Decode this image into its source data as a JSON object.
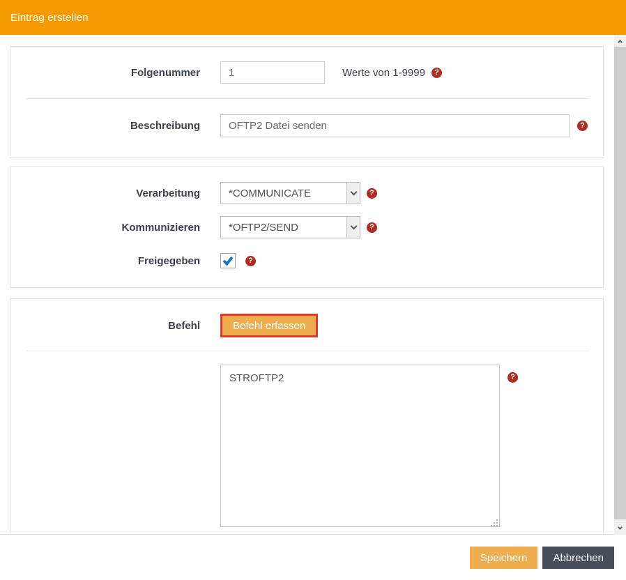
{
  "header": {
    "title": "Eintrag erstellen"
  },
  "form": {
    "folgenummer": {
      "label": "Folgenummer",
      "value": "1",
      "hint": "Werte von 1-9999"
    },
    "beschreibung": {
      "label": "Beschreibung",
      "value": "OFTP2 Datei senden"
    },
    "verarbeitung": {
      "label": "Verarbeitung",
      "value": "*COMMUNICATE"
    },
    "kommunizieren": {
      "label": "Kommunizieren",
      "value": "*OFTP2/SEND"
    },
    "freigegeben": {
      "label": "Freigegeben",
      "checked": true
    },
    "befehl": {
      "label": "Befehl",
      "button_label": "Befehl erfassen",
      "command_value": "STROFTP2"
    }
  },
  "icons": {
    "help_glyph": "?"
  },
  "footer": {
    "save_label": "Speichern",
    "cancel_label": "Abbrechen"
  },
  "colors": {
    "header_orange": "#F59B00",
    "button_amber": "#F0AD4E",
    "highlight_red_border": "#DE3B30",
    "help_icon_red": "#B02B20",
    "cancel_dark": "#474E57",
    "checkbox_check_blue": "#1779C4"
  }
}
